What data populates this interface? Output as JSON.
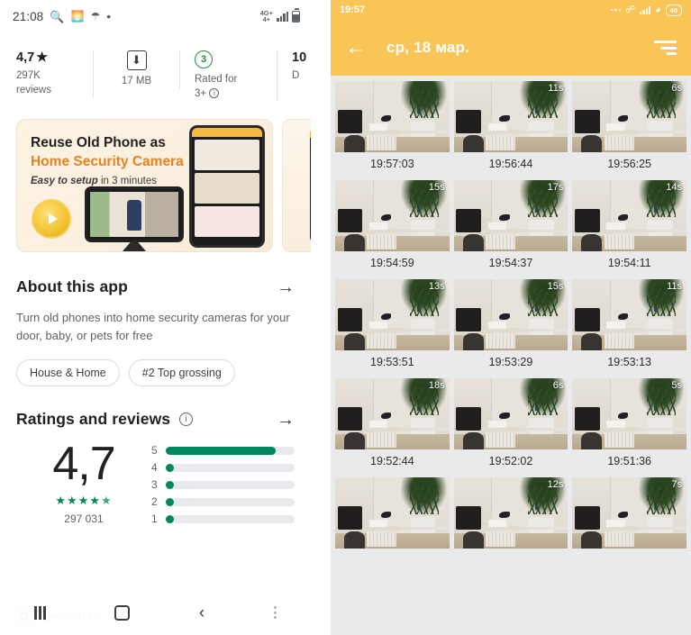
{
  "left_phone": {
    "status_bar": {
      "time": "21:08",
      "icons": [
        "search-icon",
        "weather-icon",
        "umbrella-icon",
        "dot-icon"
      ],
      "network_label": "4G+",
      "network_sub": "4+"
    },
    "app_info": [
      {
        "value": "4,7",
        "star": "★",
        "sub_line1": "297K",
        "sub_line2": "reviews"
      },
      {
        "icon": "download-icon",
        "sub_line1": "17 MB",
        "sub_line2": ""
      },
      {
        "badge": "3",
        "sub_line1": "Rated for",
        "sub_line2": "3+"
      },
      {
        "value": "10",
        "sub_line1": "D",
        "sub_line2": ""
      }
    ],
    "promo": {
      "line1": "Reuse Old Phone as",
      "line2": "Home Security Camera",
      "line3_bold": "Easy to setup",
      "line3_rest": " in 3 minutes",
      "dot_colors": [
        "#d94f3d",
        "#e8821e",
        "#3aa657",
        "#2f6fd0"
      ]
    },
    "about": {
      "title": "About this app",
      "arrow": "→",
      "description": "Turn old phones into home security cameras for your door, baby, or pets for free",
      "chips": [
        "House & Home",
        "#2 Top grossing"
      ]
    },
    "ratings": {
      "title": "Ratings and reviews",
      "info_icon": "ⓘ",
      "arrow": "→",
      "score": "4,7",
      "stars": "★★★★",
      "half_star": "★",
      "count": "297 031",
      "bars": [
        {
          "label": "5",
          "percent": 85
        },
        {
          "label": "4",
          "percent": 4
        },
        {
          "label": "3",
          "percent": 4
        },
        {
          "label": "2",
          "percent": 4
        },
        {
          "label": "1",
          "percent": 4
        }
      ],
      "accent": "#01875f",
      "track": "#e8eaed"
    },
    "bottom": {
      "account_initial": "D",
      "account_name": "Demetri C",
      "nav": [
        "recents-icon",
        "home-icon",
        "back-icon",
        "overflow-icon"
      ]
    }
  },
  "right_phone": {
    "status_bar": {
      "time": "19:57",
      "battery": "40",
      "icons": [
        "bluetooth-icon",
        "signal-icon",
        "wifi-icon",
        "battery-icon"
      ]
    },
    "app_bar": {
      "back_icon": "←",
      "title": "ср, 18 мар.",
      "sort_icon": "sort-icon",
      "bg": "#f9c557"
    },
    "recordings": [
      [
        {
          "time": "19:57:03",
          "duration": ""
        },
        {
          "time": "19:56:44",
          "duration": "11s"
        },
        {
          "time": "19:56:25",
          "duration": "6s"
        }
      ],
      [
        {
          "time": "19:54:59",
          "duration": "15s"
        },
        {
          "time": "19:54:37",
          "duration": "17s"
        },
        {
          "time": "19:54:11",
          "duration": "14s"
        }
      ],
      [
        {
          "time": "19:53:51",
          "duration": "13s"
        },
        {
          "time": "19:53:29",
          "duration": "15s"
        },
        {
          "time": "19:53:13",
          "duration": "11s"
        }
      ],
      [
        {
          "time": "19:52:44",
          "duration": "18s"
        },
        {
          "time": "19:52:02",
          "duration": "6s"
        },
        {
          "time": "19:51:36",
          "duration": "5s"
        }
      ],
      [
        {
          "time": "",
          "duration": ""
        },
        {
          "time": "",
          "duration": "12s"
        },
        {
          "time": "",
          "duration": "7s"
        }
      ]
    ]
  }
}
